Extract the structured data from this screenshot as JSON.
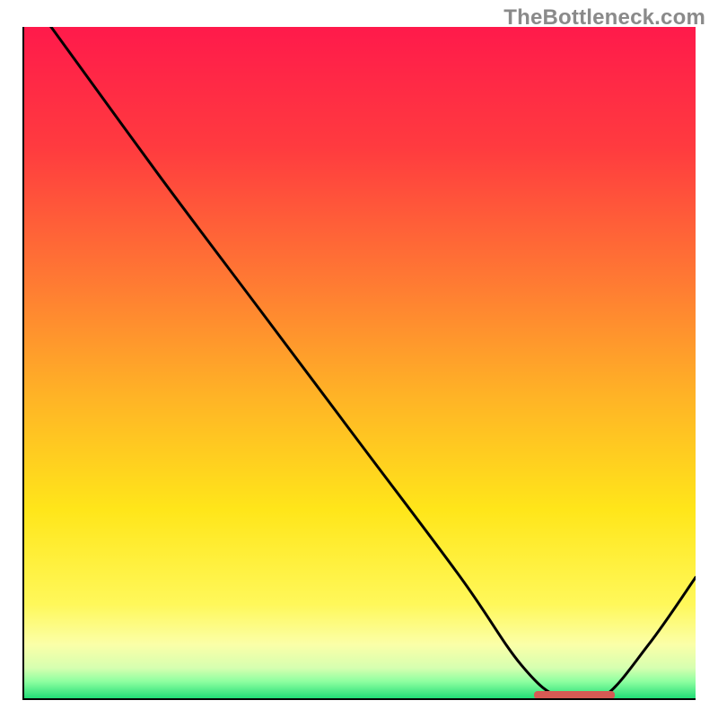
{
  "watermark": {
    "text": "TheBottleneck.com"
  },
  "chart_data": {
    "type": "line",
    "title": "",
    "xlabel": "",
    "ylabel": "",
    "xlim": [
      0,
      100
    ],
    "ylim": [
      0,
      100
    ],
    "x": [
      0,
      4,
      20,
      35,
      50,
      65,
      74,
      80,
      86,
      93,
      100
    ],
    "y": [
      105,
      100,
      78,
      58,
      38,
      18,
      5,
      0,
      0,
      8,
      18
    ],
    "optimal_band": {
      "x_start": 76,
      "x_end": 88,
      "y": 0
    },
    "gradient_stops": [
      {
        "pct": 0,
        "color": "#ff1a4b"
      },
      {
        "pct": 18,
        "color": "#ff3b3f"
      },
      {
        "pct": 38,
        "color": "#ff7a33"
      },
      {
        "pct": 55,
        "color": "#ffb326"
      },
      {
        "pct": 72,
        "color": "#ffe61a"
      },
      {
        "pct": 86,
        "color": "#fff85a"
      },
      {
        "pct": 92,
        "color": "#fbffa8"
      },
      {
        "pct": 95.5,
        "color": "#d6ffb0"
      },
      {
        "pct": 97.5,
        "color": "#8effa0"
      },
      {
        "pct": 100,
        "color": "#22dd77"
      }
    ]
  }
}
